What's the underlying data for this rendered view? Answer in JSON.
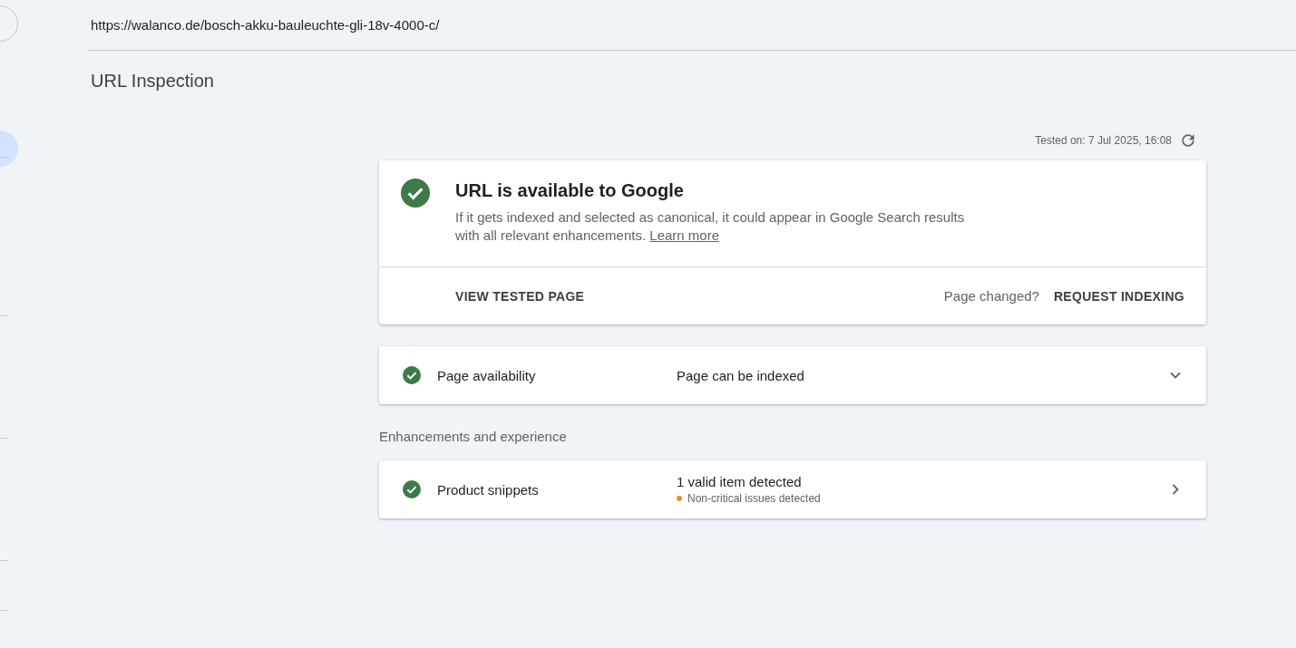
{
  "url": "https://walanco.de/bosch-akku-bauleuchte-gli-18v-4000-c/",
  "title": "URL Inspection",
  "tested_on": "Tested on: 7 Jul 2025, 16:08",
  "status_card": {
    "heading": "URL is available to Google",
    "description": "If it gets indexed and selected as canonical, it could appear in Google Search results with all relevant enhancements.",
    "link": "Learn more",
    "view_button": "VIEW TESTED PAGE",
    "changed_label": "Page changed?",
    "request_button": "REQUEST INDEXING"
  },
  "availability": [
    {
      "kind": "expand",
      "label": "Page availability",
      "status": "Page can be indexed"
    }
  ],
  "enhancements_heading": "Enhancements and experience",
  "enhancements": [
    {
      "kind": "open",
      "label": "Product snippets",
      "status": "1 valid item detected",
      "note": "Non-critical issues detected",
      "color": "#e69420"
    }
  ]
}
